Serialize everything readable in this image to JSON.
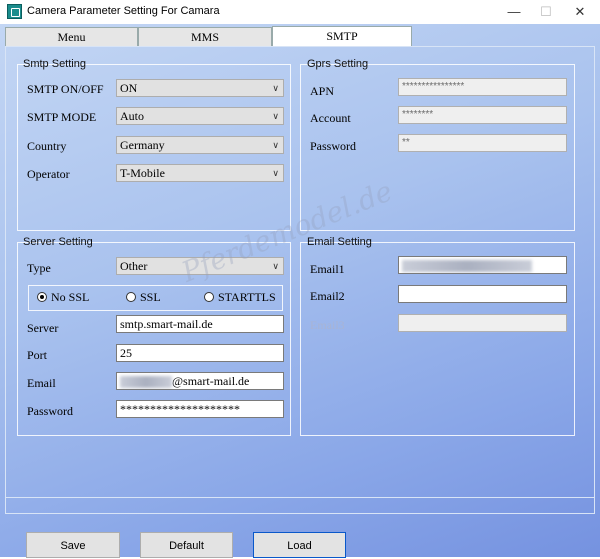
{
  "window": {
    "title": "Camera Parameter Setting For  Camara",
    "minimize": "—",
    "maximize": "☐",
    "close": "✕",
    "icon": "app-logo-icon"
  },
  "tabs": [
    {
      "label": "Menu",
      "active": false
    },
    {
      "label": "MMS",
      "active": false
    },
    {
      "label": "SMTP",
      "active": true
    }
  ],
  "smtp_setting": {
    "title": "Smtp Setting",
    "onoff_label": "SMTP ON/OFF",
    "onoff_value": "ON",
    "mode_label": "SMTP MODE",
    "mode_value": "Auto",
    "country_label": "Country",
    "country_value": "Germany",
    "operator_label": "Operator",
    "operator_value": "T-Mobile"
  },
  "gprs_setting": {
    "title": "Gprs Setting",
    "apn_label": "APN",
    "apn_value": "****************",
    "account_label": "Account",
    "account_value": "********",
    "password_label": "Password",
    "password_value": "**"
  },
  "server_setting": {
    "title": "Server Setting",
    "type_label": "Type",
    "type_value": "Other",
    "ssl_options": [
      "No SSL",
      "SSL",
      "STARTTLS"
    ],
    "ssl_selected": "No SSL",
    "server_label": "Server",
    "server_value": "smtp.smart-mail.de",
    "port_label": "Port",
    "port_value": "25",
    "email_label": "Email",
    "email_value": "@smart-mail.de",
    "password_label": "Password",
    "password_value": "********************"
  },
  "email_setting": {
    "title": "Email Setting",
    "email1_label": "Email1",
    "email2_label": "Email2",
    "email2_value": "",
    "email3_label": "Email3",
    "email3_value": ""
  },
  "watermark": "Pferdemodel.de",
  "buttons": {
    "save": "Save",
    "default": "Default",
    "load": "Load"
  },
  "colors": {
    "background_top": "#c3d6f4",
    "background_bottom": "#7592e0",
    "focus_border": "#0a58ca"
  }
}
